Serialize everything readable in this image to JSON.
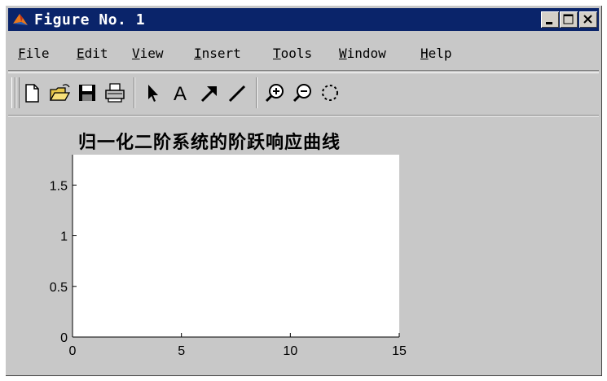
{
  "window": {
    "title": "Figure No. 1",
    "titlebar_color": "#0a246a",
    "logo_icon": "matlab-logo-icon",
    "controls": [
      {
        "name": "minimize",
        "icon": "minimize-icon"
      },
      {
        "name": "maximize",
        "icon": "maximize-icon"
      },
      {
        "name": "close",
        "icon": "close-icon"
      }
    ]
  },
  "menubar": {
    "items": [
      {
        "label": "File",
        "underline": "F",
        "rest": "ile"
      },
      {
        "label": "Edit",
        "underline": "E",
        "rest": "dit"
      },
      {
        "label": "View",
        "underline": "V",
        "rest": "iew"
      },
      {
        "label": "Insert",
        "underline": "I",
        "rest": "nsert"
      },
      {
        "label": "Tools",
        "underline": "T",
        "rest": "ools"
      },
      {
        "label": "Window",
        "underline": "W",
        "rest": "indow"
      },
      {
        "label": "Help",
        "underline": "H",
        "rest": "elp"
      }
    ]
  },
  "toolbar": {
    "tools": [
      {
        "name": "new",
        "icon": "new-file-icon"
      },
      {
        "name": "open",
        "icon": "open-folder-icon"
      },
      {
        "name": "save",
        "icon": "save-disk-icon"
      },
      {
        "name": "print",
        "icon": "printer-icon"
      },
      {
        "name": "select",
        "icon": "arrow-pointer-icon"
      },
      {
        "name": "text",
        "icon": "insert-text-icon",
        "glyph": "A"
      },
      {
        "name": "arrow",
        "icon": "insert-arrow-icon"
      },
      {
        "name": "line",
        "icon": "insert-line-icon"
      },
      {
        "name": "zoom-in",
        "icon": "zoom-in-icon"
      },
      {
        "name": "zoom-out",
        "icon": "zoom-out-icon"
      },
      {
        "name": "rotate",
        "icon": "rotate-3d-icon"
      }
    ]
  },
  "chart_data": {
    "type": "line",
    "title": "归一化二阶系统的阶跃响应曲线",
    "xlabel": "",
    "ylabel": "",
    "xlim": [
      0,
      15
    ],
    "ylim": [
      0,
      1.8
    ],
    "xticks": [
      0,
      5,
      10,
      15
    ],
    "xtick_labels": [
      "0",
      "5",
      "10",
      "15"
    ],
    "yticks": [
      0,
      0.5,
      1,
      1.5
    ],
    "ytick_labels": [
      "0",
      "0.5",
      "1",
      "1.5"
    ],
    "series": [],
    "grid": false,
    "axes_background": "#ffffff"
  }
}
